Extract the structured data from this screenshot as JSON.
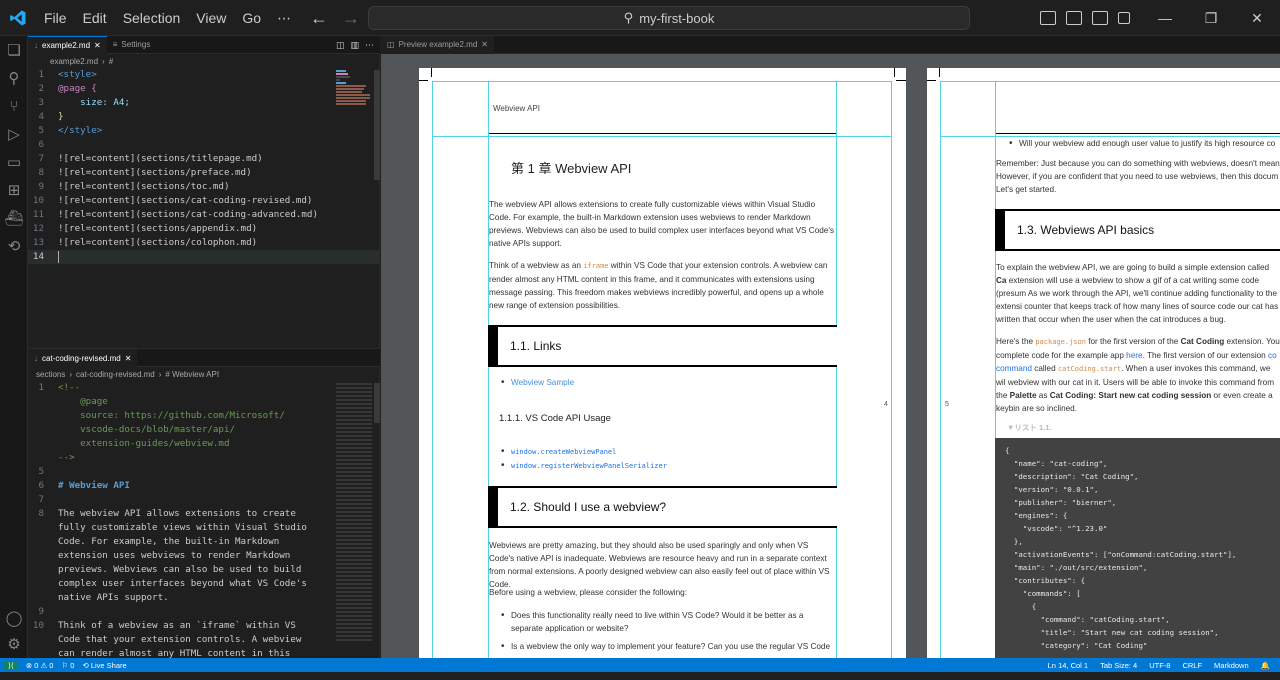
{
  "titlebar": {
    "menu": [
      "File",
      "Edit",
      "Selection",
      "View",
      "Go",
      "⋯"
    ],
    "search": "my-first-book"
  },
  "editor_top": {
    "tabs": [
      {
        "label": "example2.md",
        "active": true
      },
      {
        "label": "Settings",
        "active": false
      }
    ],
    "breadcrumb": [
      "example2.md",
      "#"
    ],
    "lines": [
      {
        "n": "1",
        "t": "<style>"
      },
      {
        "n": "2",
        "t": "@page {"
      },
      {
        "n": "3",
        "t": "    size: A4;"
      },
      {
        "n": "4",
        "t": "}"
      },
      {
        "n": "5",
        "t": "</style>"
      },
      {
        "n": "6",
        "t": ""
      },
      {
        "n": "7",
        "t": "![rel=content](sections/titlepage.md)"
      },
      {
        "n": "8",
        "t": "![rel=content](sections/preface.md)"
      },
      {
        "n": "9",
        "t": "![rel=content](sections/toc.md)"
      },
      {
        "n": "10",
        "t": "![rel=content](sections/cat-coding-revised.md)"
      },
      {
        "n": "11",
        "t": "![rel=content](sections/cat-coding-advanced.md)"
      },
      {
        "n": "12",
        "t": "![rel=content](sections/appendix.md)"
      },
      {
        "n": "13",
        "t": "![rel=content](sections/colophon.md)"
      },
      {
        "n": "14",
        "t": ""
      }
    ]
  },
  "editor_bottom": {
    "tab": "cat-coding-revised.md",
    "breadcrumb": [
      "sections",
      "cat-coding-revised.md",
      "# Webview API"
    ],
    "lines": [
      {
        "n": "1",
        "t": "<!--"
      },
      {
        "n": "",
        "t": "    @page"
      },
      {
        "n": "",
        "t": "    source: https://github.com/Microsoft/"
      },
      {
        "n": "",
        "t": "    vscode-docs/blob/master/api/"
      },
      {
        "n": "",
        "t": "    extension-guides/webview.md"
      },
      {
        "n": "",
        "t": "-->"
      },
      {
        "n": "5",
        "t": ""
      },
      {
        "n": "6",
        "t": "# Webview API"
      },
      {
        "n": "7",
        "t": ""
      },
      {
        "n": "8",
        "t": "The webview API allows extensions to create"
      },
      {
        "n": "",
        "t": "fully customizable views within Visual Studio"
      },
      {
        "n": "",
        "t": "Code. For example, the built-in Markdown"
      },
      {
        "n": "",
        "t": "extension uses webviews to render Markdown"
      },
      {
        "n": "",
        "t": "previews. Webviews can also be used to build"
      },
      {
        "n": "",
        "t": "complex user interfaces beyond what VS Code's"
      },
      {
        "n": "",
        "t": "native APIs support."
      },
      {
        "n": "9",
        "t": ""
      },
      {
        "n": "10",
        "t": "Think of a webview as an `iframe` within VS"
      },
      {
        "n": "",
        "t": "Code that your extension controls. A webview"
      },
      {
        "n": "",
        "t": "can render almost any HTML content in this"
      }
    ]
  },
  "preview": {
    "tab": "Preview example2.md",
    "page1": {
      "header": "Webview API",
      "chapter": "第 1 章 Webview API",
      "p1": "The webview API allows extensions to create fully customizable views within Visual Studio Code. For example, the built-in Markdown extension uses webviews to render Markdown previews. Webviews can also be used to build complex user interfaces beyond what VS Code's native APIs support.",
      "p2a": "Think of a webview as an ",
      "p2code": "iframe",
      "p2b": " within VS Code that your extension controls. A webview can render almost any HTML content in this frame, and it communicates with extensions using message passing. This freedom makes webviews incredibly powerful, and opens up a whole new range of extension possibilities.",
      "s1": "1.1. Links",
      "link1": "Webview Sample",
      "s11": "1.1.1. VS Code API Usage",
      "api1": "window.createWebviewPanel",
      "api2": "window.registerWebviewPanelSerializer",
      "s2": "1.2. Should I use a webview?",
      "p3": "Webviews are pretty amazing, but they should also be used sparingly and only when VS Code's native API is inadequate. Webviews are resource heavy and run in a separate context from normal extensions. A poorly designed webview can also easily feel out of place within VS Code.",
      "p4": "Before using a webview, please consider the following:",
      "b1": "Does this functionality really need to live within VS Code? Would it be better as a separate application or website?",
      "b2": "Is a webview the only way to implement your feature? Can you use the regular VS Code",
      "pagenum": "4"
    },
    "page2": {
      "b0": "Will your webview add enough user value to justify its high resource co",
      "p1": "Remember: Just because you can do something with webviews, doesn't mean However, if you are confident that you need to use webviews, then this docum Let's get started.",
      "s3": "1.3. Webviews API basics",
      "p2a": "To explain the webview API, we are going to build a simple extension called ",
      "p2bold": "Ca",
      "p2b": " extension will use a webview to show a gif of a cat writing some code (presum As we work through the API, we'll continue adding functionality to the extensi counter that keeps track of how many lines of source code our cat has written that occur when the user when the cat introduces a bug.",
      "p3a": "Here's the ",
      "p3code": "package.json",
      "p3b": " for the first version of the ",
      "p3bold": "Cat Coding",
      "p3c": " extension. You complete code for the example app ",
      "p3link": "here",
      "p3d": ". The first version of our extension ",
      "p3link2": "co",
      "p3e": "command",
      "p3f": " called ",
      "p3code2": "catCoding.start",
      "p3g": ". When a user invokes this command, we wil webview with our cat in it. Users will be able to invoke this command from the ",
      "p3bold2": "Palette",
      "p3h": " as ",
      "p3bold3": "Cat Coding: Start new cat coding session",
      "p3i": " or even create a keybin are so inclined.",
      "listing": "▼リスト 1.1.",
      "code": "{\n  \"name\": \"cat-coding\",\n  \"description\": \"Cat Coding\",\n  \"version\": \"0.0.1\",\n  \"publisher\": \"bierner\",\n  \"engines\": {\n    \"vscode\": \"^1.23.0\"\n  },\n  \"activationEvents\": [\"onCommand:catCoding.start\"],\n  \"main\": \"./out/src/extension\",\n  \"contributes\": {\n    \"commands\": [\n      {\n        \"command\": \"catCoding.start\",\n        \"title\": \"Start new cat coding session\",\n        \"category\": \"Cat Coding\"",
      "pagenum": "5"
    }
  },
  "statusbar": {
    "remote": "⟩⟨",
    "errors": "⊗ 0 ⚠ 0",
    "ports": "⚐ 0",
    "liveshare": "⟲ Live Share",
    "right": [
      "Ln 14, Col 1",
      "Tab Size: 4",
      "UTF-8",
      "CRLF",
      "Markdown",
      "🔔"
    ]
  },
  "colors": {
    "accent": "#0078d4",
    "guide": "#4fd3e0"
  }
}
